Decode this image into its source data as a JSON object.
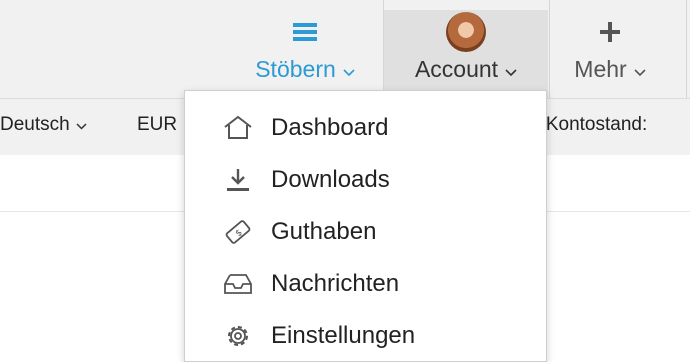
{
  "colors": {
    "accent": "#2c9ad4",
    "topbar_bg": "#f1f1f1",
    "active_nav_bg": "#e0e0e0"
  },
  "nav": {
    "browse": {
      "label": "Stöbern",
      "icon": "hamburger-menu-icon"
    },
    "account": {
      "label": "Account",
      "icon": "avatar"
    },
    "more": {
      "label": "Mehr",
      "icon": "plus-icon"
    }
  },
  "subbar": {
    "language": "Deutsch",
    "currency": "EUR",
    "balance_label": "n Kontostand:"
  },
  "account_menu": {
    "items": [
      {
        "label": "Dashboard",
        "icon": "home-icon"
      },
      {
        "label": "Downloads",
        "icon": "download-icon"
      },
      {
        "label": "Guthaben",
        "icon": "ticket-icon"
      },
      {
        "label": "Nachrichten",
        "icon": "inbox-icon"
      },
      {
        "label": "Einstellungen",
        "icon": "gear-icon"
      }
    ]
  }
}
